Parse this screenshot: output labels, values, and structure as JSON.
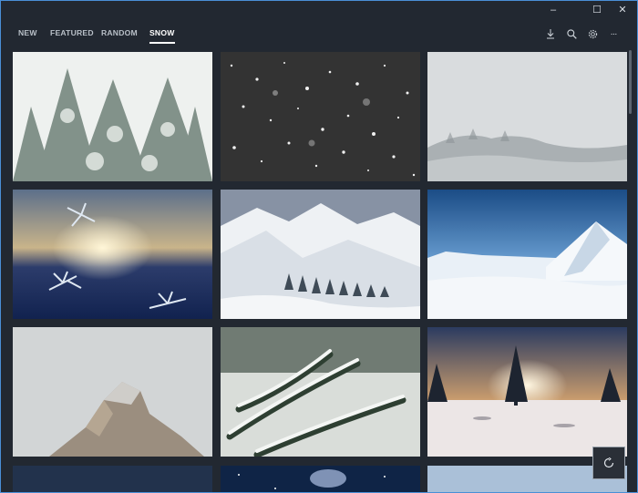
{
  "window": {
    "controls": {
      "minimize": "–",
      "maximize": "☐",
      "close": "✕"
    }
  },
  "nav": {
    "tabs": [
      {
        "label": "NEW"
      },
      {
        "label": "FEATURED"
      },
      {
        "label": "RANDOM"
      },
      {
        "label": "SNOW",
        "active": true
      }
    ]
  },
  "toolbar": {
    "icons": [
      "download-icon",
      "search-icon",
      "gear-icon",
      "more-icon"
    ],
    "more_label": "···"
  },
  "gallery": {
    "photos": [
      "snowy-pine-trees",
      "falling-snowflakes-dark",
      "foggy-snowy-hillside",
      "frost-crystals-sunset",
      "snowy-mountain-valley",
      "snow-peaks-blue-sky",
      "rocky-peak-in-fog",
      "snow-covered-pine-branch",
      "lone-tree-sunset-snowfield",
      "night-sky-partial",
      "starry-sky-partial",
      "pale-sky-partial"
    ]
  },
  "accent_color": "#ffffff"
}
